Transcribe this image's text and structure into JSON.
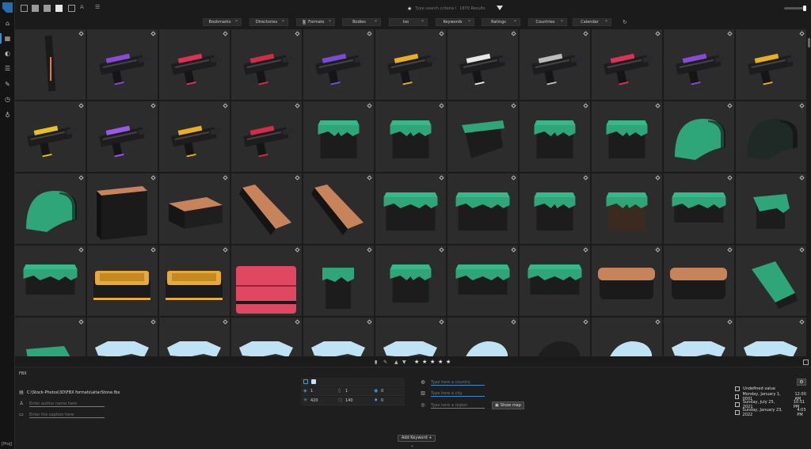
{
  "sidebar": {
    "project_label": "[Proj]",
    "items": [
      {
        "icon": "home-icon",
        "glyph": "⌂"
      },
      {
        "icon": "images-icon",
        "glyph": "▦",
        "active": true
      },
      {
        "icon": "palette-icon",
        "glyph": "◐"
      },
      {
        "icon": "layers-icon",
        "glyph": "☰"
      },
      {
        "icon": "tools-icon",
        "glyph": "✎"
      },
      {
        "icon": "clock-icon",
        "glyph": "◷"
      },
      {
        "icon": "lightbulb-icon",
        "glyph": "♁"
      }
    ]
  },
  "topbar": {
    "search_placeholder": "Type search criteria here",
    "result_count": "1870 Results"
  },
  "filters": [
    {
      "label": "Bookmarks"
    },
    {
      "label": "Directories"
    },
    {
      "label": "Formats",
      "badge": "1"
    },
    {
      "label": "Bodies"
    },
    {
      "label": "Iso"
    },
    {
      "label": "Keywords"
    },
    {
      "label": "Ratings"
    },
    {
      "label": "Countries"
    },
    {
      "label": "Calendar"
    }
  ],
  "grid": {
    "rows": [
      [
        "gun-tall",
        "gun-purple",
        "gun-pink",
        "gun-red",
        "gun-violet",
        "gun-yellow",
        "gun-white",
        "gun-grey",
        "gun-pink2",
        "gun-violet2",
        "gun-yellow2"
      ],
      [
        "gun-black",
        "gun-purple3",
        "gun-yellow3",
        "gun-red2",
        "grass-block",
        "grass-block2",
        "grass-slope",
        "grass-block3",
        "grass-block4",
        "arch-green",
        "arch-dark"
      ],
      [
        "arch-green2",
        "box-dark",
        "slab-brown",
        "ramp-brown",
        "ramp-brown2",
        "grass-wide",
        "grass-wide2",
        "grass-block5",
        "grass-dirt",
        "grass-flat",
        "grass-edge"
      ],
      [
        "grass-flat2",
        "gold-box",
        "gold-box2",
        "pink-box",
        "grass-pillar",
        "grass-cube",
        "grass-slab",
        "grass-slab2",
        "brown-slab",
        "brown-slab2",
        "grass-stairs"
      ],
      [
        "grass-mound",
        "snow-mound",
        "snow-mound2",
        "snow-cap",
        "snow-cap2",
        "snow-cap3",
        "snow-arch",
        "dark-arch",
        "snow-arch2",
        "snow-wide",
        "snow-wide2"
      ]
    ]
  },
  "rating": {
    "stars": 5
  },
  "info": {
    "file_type": "FBX",
    "file_path": "C:\\Stock-Photos\\3D\\FBX formats\\altarStone.fbx",
    "author_placeholder": "Enter author name here",
    "caption_placeholder": "Enter the caption here",
    "stats": {
      "row2": [
        "1",
        "1",
        "0"
      ],
      "row3": [
        "420",
        "140",
        "0"
      ]
    },
    "geo": {
      "country_placeholder": "Type here a country",
      "city_placeholder": "Type here a city",
      "region_placeholder": "Type here a region",
      "show_map_label": "Show map"
    },
    "dates": [
      {
        "label": "Undefined value",
        "time": ""
      },
      {
        "label": "Monday, January 1, 0001",
        "time": "12:00 AM"
      },
      {
        "label": "Sunday, July 25, 2021",
        "time": "10:51 PM"
      },
      {
        "label": "Sunday, January 23, 2022",
        "time": "4:03 PM"
      }
    ],
    "add_keyword_label": "Add Keyword +"
  },
  "colors": {
    "accent": "#2d8fe0",
    "grass": "#2fa57a",
    "dirt": "#1f1f1f",
    "brown": "#c7845a",
    "gold": "#e8a93a",
    "pink": "#e14760",
    "snow": "#bfe3f5"
  }
}
